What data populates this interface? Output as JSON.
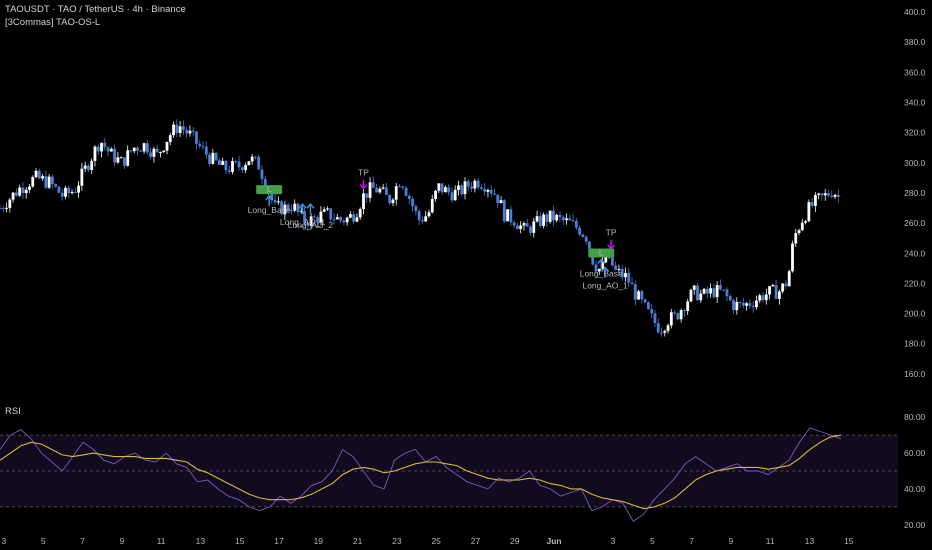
{
  "header": {
    "symbol_line": "TAOUSDT · TAO / TetherUS · 4h · Binance",
    "indicator": "[3Commas] TAO-OS-L",
    "rsi_label": "RSI"
  },
  "colors": {
    "background": "#000000",
    "candle_up": "#ffffff",
    "candle_down": "#4a7fd6",
    "rsi_line": "#7e57c2",
    "rsi_ma": "#d8b93a",
    "rsi_band_fill": "#120b1f",
    "signal_green": "#43a047",
    "signal_arrow": "#4a90e2",
    "tp_arrow": "#d500f9",
    "axis_text": "#b2b5be"
  },
  "chart_data": [
    {
      "type": "candlestick",
      "title": "TAOUSDT · TAO / TetherUS · 4h · Binance",
      "y_axis": {
        "ticks": [
          "400.0",
          "380.0",
          "360.0",
          "340.0",
          "320.0",
          "300.0",
          "280.0",
          "260.0",
          "240.0",
          "220.0",
          "200.0",
          "180.0",
          "160.0"
        ],
        "range": [
          146,
          408
        ],
        "side": "right"
      },
      "x_axis": {
        "ticks": [
          "3",
          "5",
          "7",
          "9",
          "11",
          "13",
          "15",
          "17",
          "19",
          "21",
          "23",
          "25",
          "27",
          "29",
          "Jun",
          "3",
          "5",
          "7",
          "9",
          "11",
          "13",
          "15"
        ],
        "days_span": [
          2.0,
          47.5
        ]
      },
      "series": [
        {
          "name": "TAOUSDT",
          "close_path": [
            [
              2.0,
              270
            ],
            [
              3.0,
              283
            ],
            [
              3.8,
              290
            ],
            [
              4.5,
              287
            ],
            [
              5.2,
              278
            ],
            [
              5.8,
              282
            ],
            [
              6.5,
              300
            ],
            [
              7.1,
              315
            ],
            [
              7.6,
              306
            ],
            [
              8.2,
              300
            ],
            [
              8.8,
              310
            ],
            [
              9.4,
              312
            ],
            [
              10.0,
              305
            ],
            [
              10.6,
              318
            ],
            [
              11.1,
              325
            ],
            [
              11.7,
              318
            ],
            [
              12.2,
              310
            ],
            [
              12.8,
              302
            ],
            [
              13.4,
              296
            ],
            [
              14.2,
              298
            ],
            [
              14.7,
              303
            ],
            [
              15.2,
              298
            ],
            [
              15.6,
              283
            ],
            [
              16.0,
              270
            ],
            [
              16.5,
              270
            ],
            [
              16.9,
              272
            ],
            [
              17.4,
              262
            ],
            [
              17.9,
              262
            ],
            [
              18.3,
              265
            ],
            [
              18.7,
              266
            ],
            [
              19.3,
              262
            ],
            [
              19.7,
              263
            ],
            [
              20.1,
              267
            ],
            [
              20.5,
              278
            ],
            [
              20.9,
              283
            ],
            [
              21.3,
              282
            ],
            [
              21.8,
              275
            ],
            [
              22.4,
              290
            ],
            [
              22.8,
              278
            ],
            [
              23.3,
              262
            ],
            [
              23.8,
              266
            ],
            [
              24.3,
              284
            ],
            [
              24.9,
              280
            ],
            [
              25.3,
              280
            ],
            [
              25.8,
              285
            ],
            [
              26.3,
              288
            ],
            [
              26.8,
              285
            ],
            [
              27.3,
              278
            ],
            [
              27.7,
              265
            ],
            [
              28.2,
              262
            ],
            [
              28.7,
              255
            ],
            [
              29.1,
              258
            ],
            [
              29.7,
              263
            ],
            [
              30.1,
              264
            ],
            [
              30.5,
              262
            ],
            [
              31.0,
              260
            ],
            [
              31.5,
              256
            ],
            [
              31.9,
              250
            ],
            [
              32.2,
              234
            ],
            [
              32.6,
              228
            ],
            [
              32.9,
              240
            ],
            [
              33.3,
              228
            ],
            [
              33.9,
              224
            ],
            [
              34.3,
              214
            ],
            [
              34.7,
              206
            ],
            [
              35.2,
              196
            ],
            [
              35.6,
              190
            ],
            [
              36.0,
              196
            ],
            [
              36.4,
              198
            ],
            [
              36.9,
              208
            ],
            [
              37.3,
              214
            ],
            [
              37.8,
              212
            ],
            [
              38.3,
              215
            ],
            [
              38.8,
              214
            ],
            [
              39.3,
              206
            ],
            [
              39.8,
              205
            ],
            [
              40.3,
              208
            ],
            [
              40.8,
              212
            ],
            [
              41.2,
              214
            ],
            [
              41.7,
              215
            ],
            [
              42.1,
              222
            ],
            [
              42.4,
              250
            ],
            [
              42.8,
              262
            ],
            [
              43.2,
              270
            ],
            [
              43.6,
              275
            ],
            [
              44.0,
              278
            ],
            [
              44.4,
              282
            ],
            [
              44.8,
              275
            ]
          ]
        }
      ],
      "annotations": [
        {
          "text": "Long_Base",
          "box": "L",
          "day": 15.7,
          "price": 258
        },
        {
          "text": "Long_AO_1",
          "day": 17.4,
          "price": 258
        },
        {
          "text": "Long_AO_2",
          "day": 17.8,
          "price": 258
        },
        {
          "text": "TP",
          "day": 20.5,
          "price": 285
        },
        {
          "text": "TP",
          "day": 33.1,
          "price": 245
        },
        {
          "text": "Long_Base",
          "box": "L",
          "day": 32.6,
          "price": 216
        },
        {
          "text": "Long_AO_1",
          "day": 32.8,
          "price": 216
        }
      ]
    },
    {
      "type": "line",
      "title": "RSI",
      "y_axis": {
        "ticks": [
          "80.00",
          "60.00",
          "40.00",
          "20.00"
        ],
        "range": [
          16,
          84
        ],
        "bands": [
          70,
          50,
          30
        ]
      },
      "series": [
        {
          "name": "RSI",
          "values": [
            62,
            70,
            73,
            68,
            60,
            55,
            50,
            58,
            66,
            62,
            56,
            54,
            58,
            60,
            56,
            55,
            60,
            54,
            52,
            44,
            45,
            40,
            36,
            34,
            30,
            28,
            30,
            36,
            32,
            36,
            42,
            44,
            50,
            62,
            58,
            50,
            42,
            40,
            56,
            60,
            62,
            55,
            58,
            52,
            48,
            44,
            42,
            40,
            46,
            44,
            46,
            50,
            42,
            40,
            36,
            38,
            40,
            28,
            30,
            34,
            32,
            22,
            26,
            34,
            40,
            46,
            54,
            58,
            54,
            50,
            52,
            54,
            50,
            50,
            48,
            52,
            56,
            66,
            74,
            72,
            70,
            68
          ]
        },
        {
          "name": "RSI MA",
          "values": [
            56,
            60,
            64,
            66,
            65,
            62,
            59,
            58,
            59,
            60,
            59,
            58,
            58,
            58,
            57,
            57,
            57,
            56,
            55,
            51,
            49,
            46,
            43,
            40,
            37,
            35,
            34,
            34,
            34,
            35,
            37,
            40,
            43,
            48,
            51,
            52,
            51,
            49,
            50,
            52,
            54,
            55,
            55,
            54,
            53,
            50,
            48,
            46,
            45,
            45,
            45,
            46,
            45,
            43,
            42,
            40,
            40,
            37,
            35,
            34,
            33,
            31,
            29,
            30,
            32,
            35,
            40,
            45,
            48,
            50,
            51,
            52,
            52,
            52,
            51,
            52,
            53,
            57,
            62,
            66,
            69,
            70
          ]
        }
      ]
    }
  ]
}
